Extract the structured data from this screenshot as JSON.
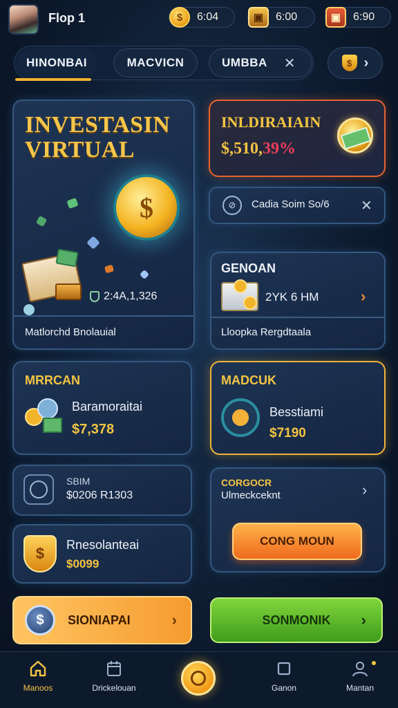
{
  "app": {
    "title": "Flop 1"
  },
  "currencies": [
    {
      "icon": "coin-icon",
      "value": "6:04"
    },
    {
      "icon": "chest-icon",
      "value": "6:00"
    },
    {
      "icon": "treasure-chest-icon",
      "value": "6:90"
    }
  ],
  "tabs": [
    {
      "label": "HINONBAI",
      "active": true
    },
    {
      "label": "MACVICN",
      "active": false
    },
    {
      "label": "UMBBA",
      "active": false
    }
  ],
  "hero": {
    "title_line1": "INVESTASIN",
    "title_line2": "VIRTUAL",
    "stat": "2:4A,1,326",
    "footer": "Matlorchd Bnolauial"
  },
  "top_right_card": {
    "title": "INLDIRAIAIN",
    "amount": "$,510,",
    "percent": "39%"
  },
  "search_card": {
    "text": "Cadia Soim So/6"
  },
  "general_card": {
    "title": "GENOAN",
    "value": "2YK 6 HM",
    "footer": "Lloopka Rergdtaala"
  },
  "card_mrrcan": {
    "title": "MRRCAN",
    "label": "Baramoraitai",
    "amount": "$7,378"
  },
  "card_madcuk": {
    "title": "MADCUK",
    "label": "Besstiami",
    "amount": "$7190"
  },
  "card_sbim": {
    "label": "SBIM",
    "value": "$0206 R1303"
  },
  "card_corgocr": {
    "title": "CORGOCR",
    "subtitle": "Ulmeckceknt",
    "button": "CONG MOUN"
  },
  "card_rnesolan": {
    "label": "Rnesolanteai",
    "amount": "$0099"
  },
  "cta_left": {
    "label": "SIONIAPAI"
  },
  "cta_right": {
    "label": "SONMONIK"
  },
  "nav": [
    {
      "icon": "home-icon",
      "label": "Manoos"
    },
    {
      "icon": "calendar-icon",
      "label": "Drickelouan"
    },
    {
      "icon": "center-action-icon",
      "label": ""
    },
    {
      "icon": "square-icon",
      "label": "Ganon"
    },
    {
      "icon": "profile-icon",
      "label": "Mantan"
    }
  ]
}
